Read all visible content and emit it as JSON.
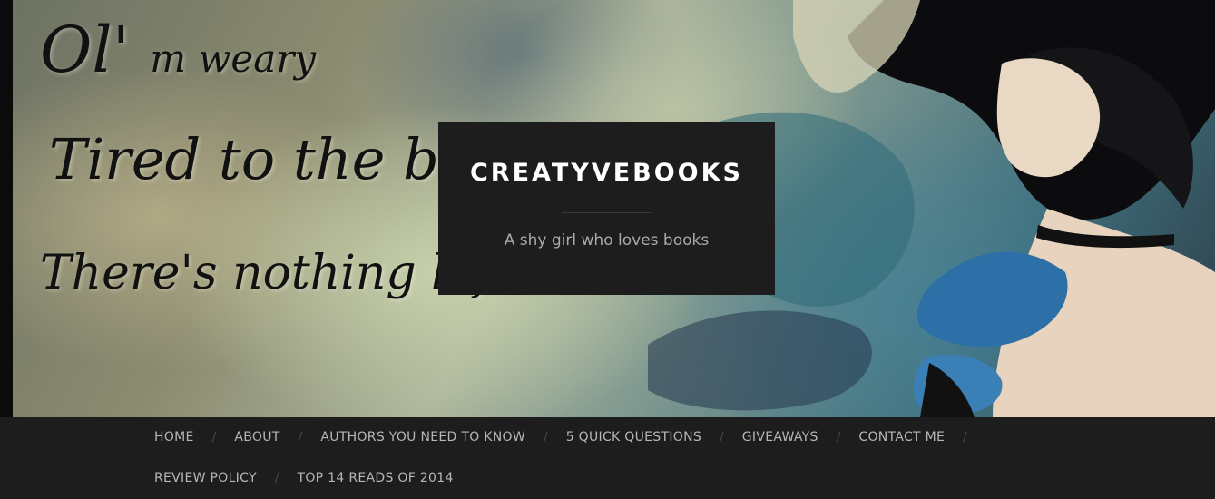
{
  "header": {
    "banner_text": {
      "line1_a": "Ol'",
      "line1_b": "m weary",
      "line2": "Tired to the bone",
      "line3": "There's nothing left"
    },
    "site_title": "CREATYVEBOOKS",
    "tagline": "A shy girl who loves books"
  },
  "nav": {
    "row1": [
      "HOME",
      "ABOUT",
      "AUTHORS YOU NEED TO KNOW",
      "5 QUICK QUESTIONS",
      "GIVEAWAYS",
      "CONTACT ME"
    ],
    "row2": [
      "REVIEW POLICY",
      "TOP 14 READS OF 2014"
    ],
    "separator": "/"
  },
  "colors": {
    "background": "#1d1d1d",
    "title": "#ffffff",
    "tagline": "#a9a9a9",
    "nav_text": "#b7b7b7",
    "separator": "#474747"
  }
}
